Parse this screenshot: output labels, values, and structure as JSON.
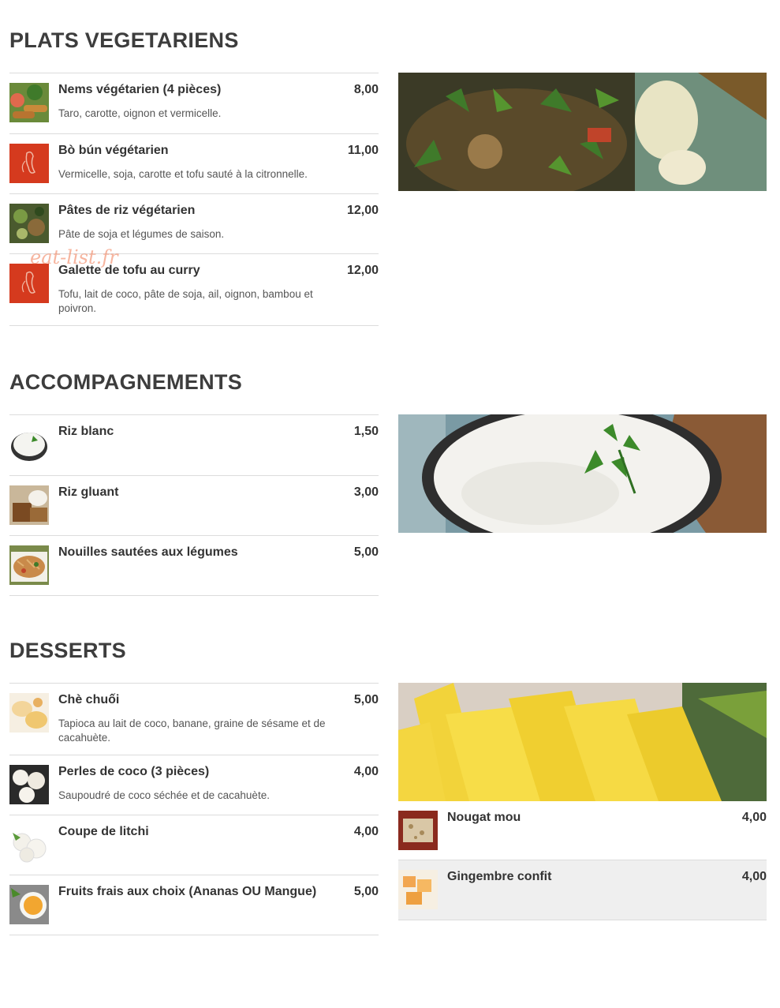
{
  "watermark": "eat-list.fr",
  "sections": [
    {
      "title": "PLATS VEGETARIENS",
      "items": [
        {
          "name": "Nems végétarien (4 pièces)",
          "price": "8,00",
          "desc": "Taro, carotte, oignon et vermicelle."
        },
        {
          "name": "Bò bún végétarien",
          "price": "11,00",
          "desc": "Vermicelle, soja, carotte et tofu sauté à la citronnelle."
        },
        {
          "name": "Pâtes de riz végétarien",
          "price": "12,00",
          "desc": "Pâte de soja et légumes de saison."
        },
        {
          "name": "Galette de tofu au curry",
          "price": "12,00",
          "desc": "Tofu, lait de coco, pâte de soja, ail, oignon, bambou et poivron."
        }
      ]
    },
    {
      "title": "ACCOMPAGNEMENTS",
      "items": [
        {
          "name": "Riz blanc",
          "price": "1,50"
        },
        {
          "name": "Riz gluant",
          "price": "3,00"
        },
        {
          "name": "Nouilles sautées aux légumes",
          "price": "5,00"
        }
      ]
    },
    {
      "title": "DESSERTS",
      "items": [
        {
          "name": "Chè chuối",
          "price": "5,00",
          "desc": "Tapioca au lait de coco, banane, graine de sésame et de cacahuète."
        },
        {
          "name": "Perles de coco (3 pièces)",
          "price": "4,00",
          "desc": "Saupoudré de coco séchée et de cacahuète."
        },
        {
          "name": "Coupe de litchi",
          "price": "4,00"
        },
        {
          "name": "Fruits frais aux choix (Ananas OU Mangue)",
          "price": "5,00"
        }
      ],
      "side_items": [
        {
          "name": "Nougat mou",
          "price": "4,00"
        },
        {
          "name": "Gingembre confit",
          "price": "4,00"
        }
      ]
    }
  ],
  "colors": {
    "logo_red": "#d53a1e",
    "divider": "#dcdcdc",
    "title": "#3d3d3d"
  }
}
